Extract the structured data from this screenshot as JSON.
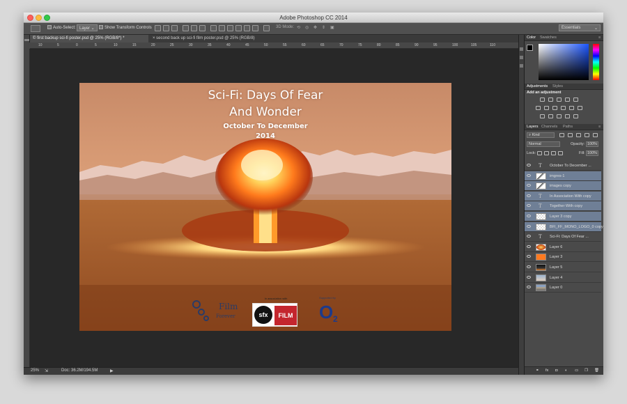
{
  "app": {
    "title": "Adobe Photoshop CC 2014"
  },
  "options_bar": {
    "auto_select_label": "Auto-Select:",
    "auto_select_value": "Layer",
    "show_transform_label": "Show Transform Controls",
    "mode_3d_label": "3D Mode:",
    "workspace": "Essentials"
  },
  "tabs": [
    {
      "label": "© first backup sci-fi poster.psd @ 25% (RGB/8*) *"
    },
    {
      "label": "second back up sci-fi film poster.psd @ 25% (RGB/8)"
    }
  ],
  "ruler": {
    "h_marks": [
      "10",
      "5",
      "0",
      "5",
      "10",
      "15",
      "20",
      "25",
      "30",
      "35",
      "40",
      "45",
      "50",
      "55",
      "60",
      "65",
      "70",
      "75",
      "80",
      "85",
      "90",
      "95",
      "100",
      "105",
      "110"
    ]
  },
  "poster": {
    "title_line1": "Sci-Fi: Days Of Fear",
    "title_line2": "And Wonder",
    "date_line1": "October To December",
    "date_line2": "2014",
    "in_association": "In association with",
    "sponsor_label": "Supported by",
    "bfi_text": "Film",
    "bfi_sub": "Forever",
    "sfx_text": "sfx",
    "film_text": "FILM",
    "o2_text": "O",
    "o2_sub": "2"
  },
  "status": {
    "zoom": "25%",
    "doc": "Doc: 36.2M/194.5M"
  },
  "color_panel": {
    "tab1": "Color",
    "tab2": "Swatches"
  },
  "adjustments_panel": {
    "tab1": "Adjustments",
    "tab2": "Styles",
    "add_label": "Add an adjustment"
  },
  "layers_panel": {
    "tab1": "Layers",
    "tab2": "Channels",
    "tab3": "Paths",
    "kind_label": "Kind",
    "blend_mode": "Normal",
    "opacity_label": "Opacity:",
    "opacity_value": "100%",
    "lock_label": "Lock:",
    "fill_label": "Fill:",
    "fill_value": "100%",
    "layers": [
      {
        "name": "October To December ...",
        "type": "text",
        "selected": false
      },
      {
        "name": "imgres-1",
        "type": "image",
        "selected": true
      },
      {
        "name": "images copy",
        "type": "image",
        "selected": true
      },
      {
        "name": "In Association With copy",
        "type": "text",
        "selected": true
      },
      {
        "name": "Together With copy",
        "type": "text",
        "selected": true
      },
      {
        "name": "Layer 3 copy",
        "type": "transparent",
        "selected": true
      },
      {
        "name": "BFI_FF_MONO_LOGO_0 copy",
        "type": "transparent",
        "selected": true
      },
      {
        "name": "Sci-Fi: Days Of Fear ...",
        "type": "text",
        "selected": false
      },
      {
        "name": "Layer 6",
        "type": "explosion",
        "selected": false
      },
      {
        "name": "Layer 3",
        "type": "orange",
        "selected": false
      },
      {
        "name": "Layer 5",
        "type": "dark",
        "selected": false
      },
      {
        "name": "Layer 4",
        "type": "sky",
        "selected": false
      },
      {
        "name": "Layer 0",
        "type": "mountain",
        "selected": false
      }
    ]
  },
  "colors": {
    "selected_layer_bg": "#6f7f96",
    "layer_bg": "#4a4a4a",
    "foreground": "#000000",
    "background": "#ffffff"
  }
}
